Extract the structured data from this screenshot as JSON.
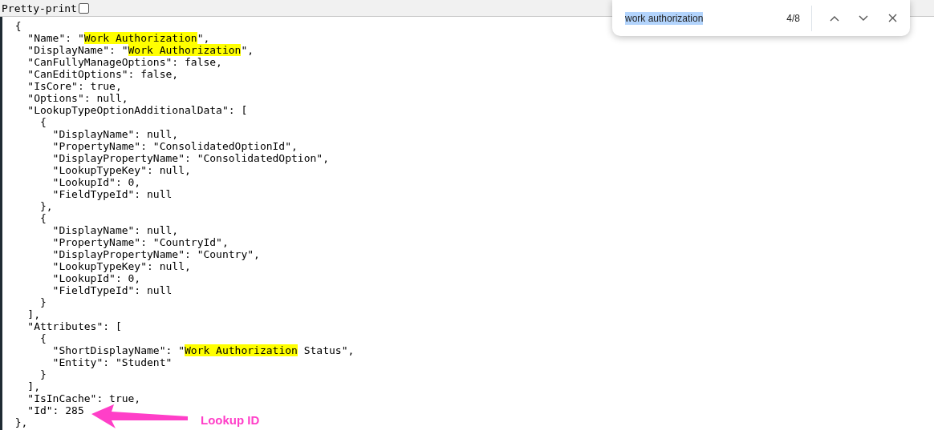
{
  "toolbar": {
    "label": "Pretty-print",
    "checked": false
  },
  "code_lines": [
    [
      {
        "text": "  {",
        "highlighted": false
      }
    ],
    [
      {
        "text": "    \"Name\": \"",
        "highlighted": false
      },
      {
        "text": "Work Authorization",
        "highlighted": true
      },
      {
        "text": "\",",
        "highlighted": false
      }
    ],
    [
      {
        "text": "    \"DisplayName\": \"",
        "highlighted": false
      },
      {
        "text": "Work Authorization",
        "highlighted": true
      },
      {
        "text": "\",",
        "highlighted": false
      }
    ],
    [
      {
        "text": "    \"CanFullyManageOptions\": false,",
        "highlighted": false
      }
    ],
    [
      {
        "text": "    \"CanEditOptions\": false,",
        "highlighted": false
      }
    ],
    [
      {
        "text": "    \"IsCore\": true,",
        "highlighted": false
      }
    ],
    [
      {
        "text": "    \"Options\": null,",
        "highlighted": false
      }
    ],
    [
      {
        "text": "    \"LookupTypeOptionAdditionalData\": [",
        "highlighted": false
      }
    ],
    [
      {
        "text": "      {",
        "highlighted": false
      }
    ],
    [
      {
        "text": "        \"DisplayName\": null,",
        "highlighted": false
      }
    ],
    [
      {
        "text": "        \"PropertyName\": \"ConsolidatedOptionId\",",
        "highlighted": false
      }
    ],
    [
      {
        "text": "        \"DisplayPropertyName\": \"ConsolidatedOption\",",
        "highlighted": false
      }
    ],
    [
      {
        "text": "        \"LookupTypeKey\": null,",
        "highlighted": false
      }
    ],
    [
      {
        "text": "        \"LookupId\": 0,",
        "highlighted": false
      }
    ],
    [
      {
        "text": "        \"FieldTypeId\": null",
        "highlighted": false
      }
    ],
    [
      {
        "text": "      },",
        "highlighted": false
      }
    ],
    [
      {
        "text": "      {",
        "highlighted": false
      }
    ],
    [
      {
        "text": "        \"DisplayName\": null,",
        "highlighted": false
      }
    ],
    [
      {
        "text": "        \"PropertyName\": \"CountryId\",",
        "highlighted": false
      }
    ],
    [
      {
        "text": "        \"DisplayPropertyName\": \"Country\",",
        "highlighted": false
      }
    ],
    [
      {
        "text": "        \"LookupTypeKey\": null,",
        "highlighted": false
      }
    ],
    [
      {
        "text": "        \"LookupId\": 0,",
        "highlighted": false
      }
    ],
    [
      {
        "text": "        \"FieldTypeId\": null",
        "highlighted": false
      }
    ],
    [
      {
        "text": "      }",
        "highlighted": false
      }
    ],
    [
      {
        "text": "    ],",
        "highlighted": false
      }
    ],
    [
      {
        "text": "    \"Attributes\": [",
        "highlighted": false
      }
    ],
    [
      {
        "text": "      {",
        "highlighted": false
      }
    ],
    [
      {
        "text": "        \"ShortDisplayName\": \"",
        "highlighted": false
      },
      {
        "text": "Work Authorization",
        "highlighted": true
      },
      {
        "text": " Status\",",
        "highlighted": false
      }
    ],
    [
      {
        "text": "        \"Entity\": \"Student\"",
        "highlighted": false
      }
    ],
    [
      {
        "text": "      }",
        "highlighted": false
      }
    ],
    [
      {
        "text": "    ],",
        "highlighted": false
      }
    ],
    [
      {
        "text": "    \"IsInCache\": true,",
        "highlighted": false
      }
    ],
    [
      {
        "text": "    \"Id\": 285",
        "highlighted": false
      }
    ],
    [
      {
        "text": "  },",
        "highlighted": false
      }
    ]
  ],
  "find_bar": {
    "value": "work authorization",
    "count": "4/8"
  },
  "annotation": {
    "label": "Lookup ID"
  }
}
